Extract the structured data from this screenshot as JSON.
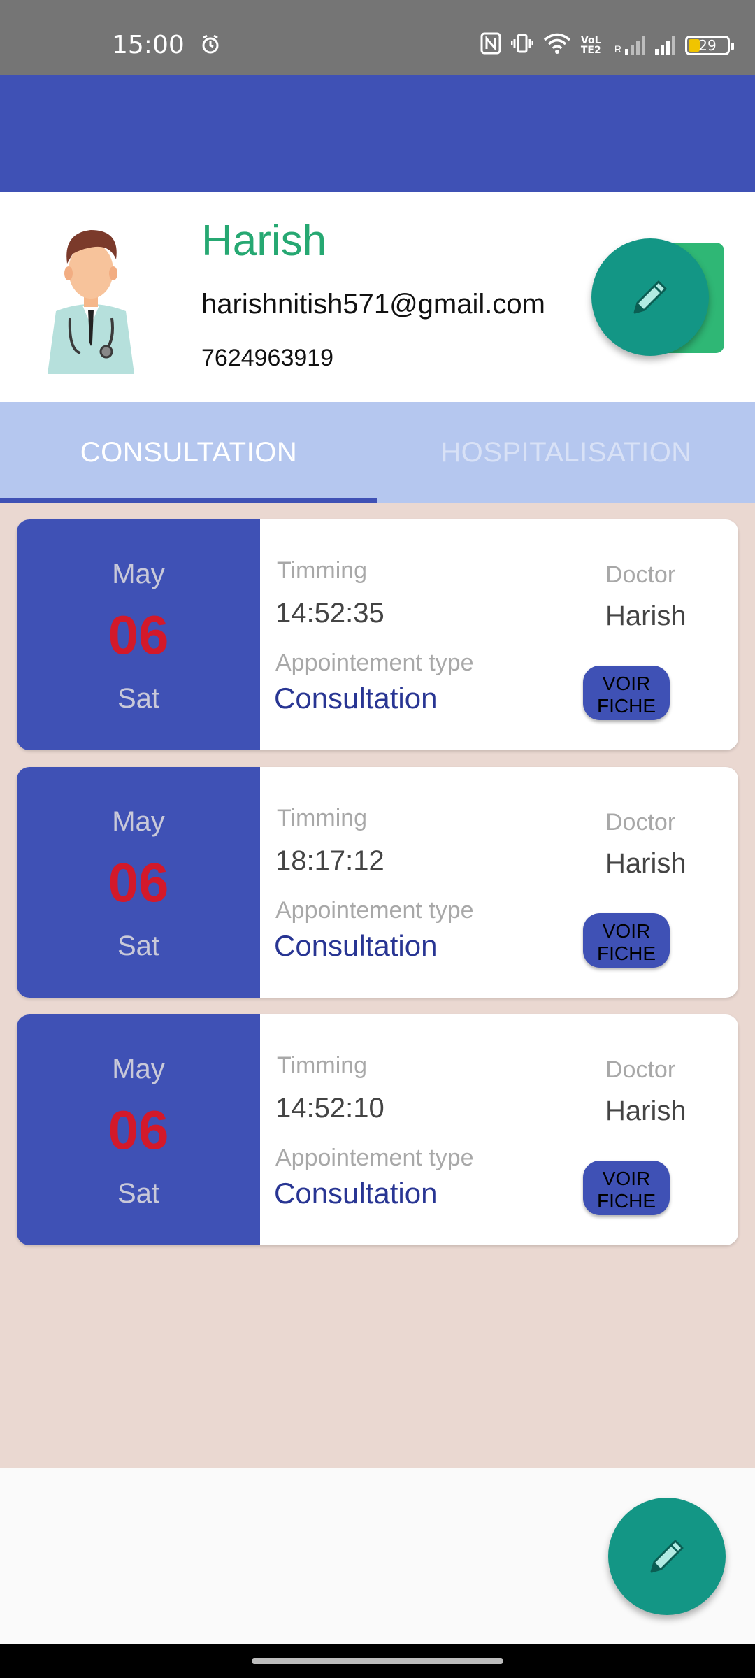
{
  "status_bar": {
    "time": "15:00",
    "battery": "29",
    "network_label": "VoLTE2",
    "signal_label": "R"
  },
  "profile": {
    "name": "Harish",
    "email": "harishnitish571@gmail.com",
    "phone": "7624963919"
  },
  "tabs": [
    {
      "label": "CONSULTATION",
      "selected": true
    },
    {
      "label": "HOSPITALISATION",
      "selected": false
    }
  ],
  "labels": {
    "timing": "Timming",
    "appointment_type": "Appointement type",
    "doctor": "Doctor",
    "voir_line1": "VOIR",
    "voir_line2": "FICHE"
  },
  "appointments": [
    {
      "month": "May",
      "day": "06",
      "weekday": "Sat",
      "time": "14:52:35",
      "type": "Consultation",
      "doctor": "Harish"
    },
    {
      "month": "May",
      "day": "06",
      "weekday": "Sat",
      "time": "18:17:12",
      "type": "Consultation",
      "doctor": "Harish"
    },
    {
      "month": "May",
      "day": "06",
      "weekday": "Sat",
      "time": "14:52:10",
      "type": "Consultation",
      "doctor": "Harish"
    }
  ],
  "icons": {
    "alarm": "alarm-icon",
    "nfc": "nfc-icon",
    "vibrate": "vibrate-icon",
    "wifi": "wifi-icon",
    "signal": "signal-icon",
    "edit": "pencil-icon"
  },
  "colors": {
    "primary": "#3f51b5",
    "accent": "#139685",
    "name_green": "#26a872",
    "day_red": "#d3192a",
    "list_bg": "#ead8d1",
    "tab_bg": "#b5c7ef"
  }
}
